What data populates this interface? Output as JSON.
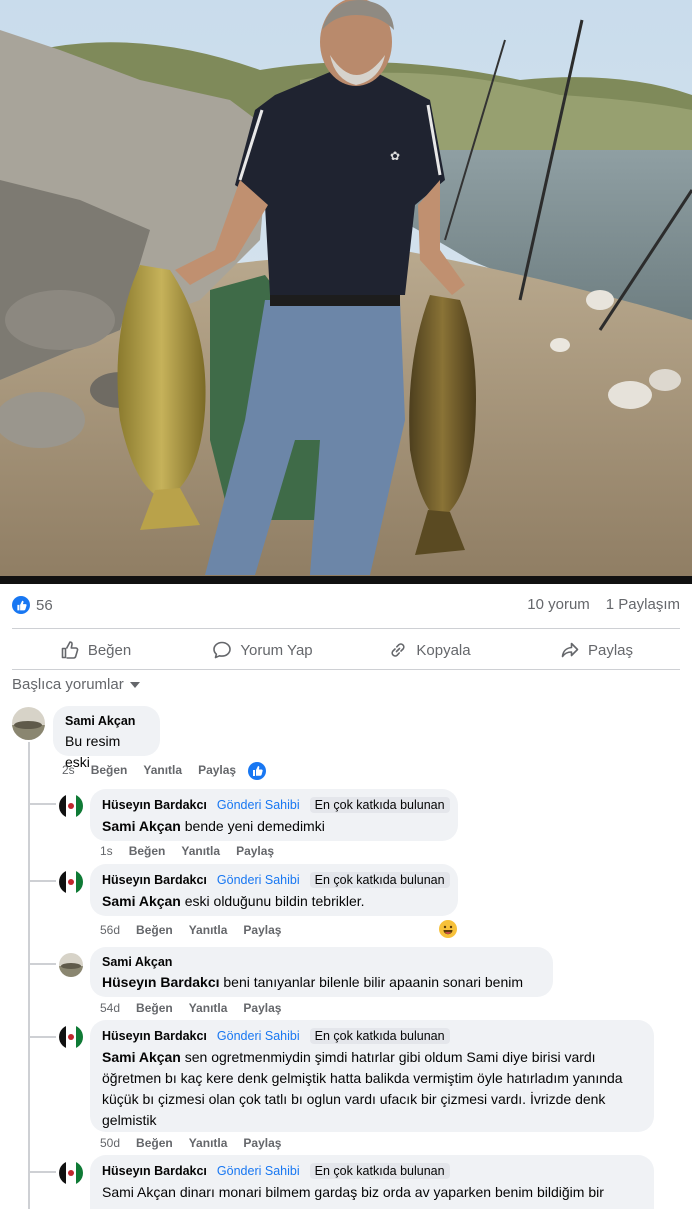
{
  "post": {
    "image_alt": "fishing-photo",
    "like_count": "56",
    "comment_count": "10 yorum",
    "share_count": "1 Paylaşım"
  },
  "actions": {
    "like": "Beğen",
    "comment": "Yorum Yap",
    "copy": "Kopyala",
    "share": "Paylaş"
  },
  "sort_label": "Başlıca yorumlar",
  "comments": [
    {
      "author": "Sami Akçan",
      "text": "Bu resim eski",
      "time": "2s",
      "like": "Beğen",
      "reply": "Yanıtla",
      "share": "Paylaş"
    },
    {
      "author": "Hüseyın Bardakcı",
      "badge_author": "Gönderi Sahibi",
      "badge_top": "En çok katkıda bulunan",
      "mention": "Sami Akçan",
      "text": " bende yeni demedimki",
      "time": "1s",
      "like": "Beğen",
      "reply": "Yanıtla",
      "share": "Paylaş"
    },
    {
      "author": "Hüseyın Bardakcı",
      "badge_author": "Gönderi Sahibi",
      "badge_top": "En çok katkıda bulunan",
      "mention": "Sami Akçan",
      "text": " eski olduğunu bildin tebrikler.",
      "time": "56d",
      "like": "Beğen",
      "reply": "Yanıtla",
      "share": "Paylaş"
    },
    {
      "author": "Sami Akçan",
      "mention": "Hüseyın Bardakcı",
      "text": " beni tanıyanlar bilenle bilir apaanin sonari benim",
      "time": "54d",
      "like": "Beğen",
      "reply": "Yanıtla",
      "share": "Paylaş"
    },
    {
      "author": "Hüseyın Bardakcı",
      "badge_author": "Gönderi Sahibi",
      "badge_top": "En çok katkıda bulunan",
      "mention": "Sami Akçan",
      "text": " sen ogretmenmiydin şimdi hatırlar gibi oldum Sami diye birisi vardı öğretmen bı kaç kere denk gelmiştik hatta balikda vermiştim öyle hatırladım yanında küçük bı çizmesi olan çok tatlı bı oglun vardı ufacık bir çizmesi vardı. İvrizde denk gelmistik",
      "time": "50d",
      "like": "Beğen",
      "reply": "Yanıtla",
      "share": "Paylaş"
    },
    {
      "author": "Hüseyın Bardakcı",
      "badge_author": "Gönderi Sahibi",
      "badge_top": "En çok katkıda bulunan",
      "text": "Sami Akçan dinarı monari bilmem gardaş biz orda av yaparken benim bildiğim bir"
    }
  ],
  "colors": {
    "accent": "#1877f2",
    "bubble": "#f0f2f5",
    "muted": "#65676b"
  }
}
